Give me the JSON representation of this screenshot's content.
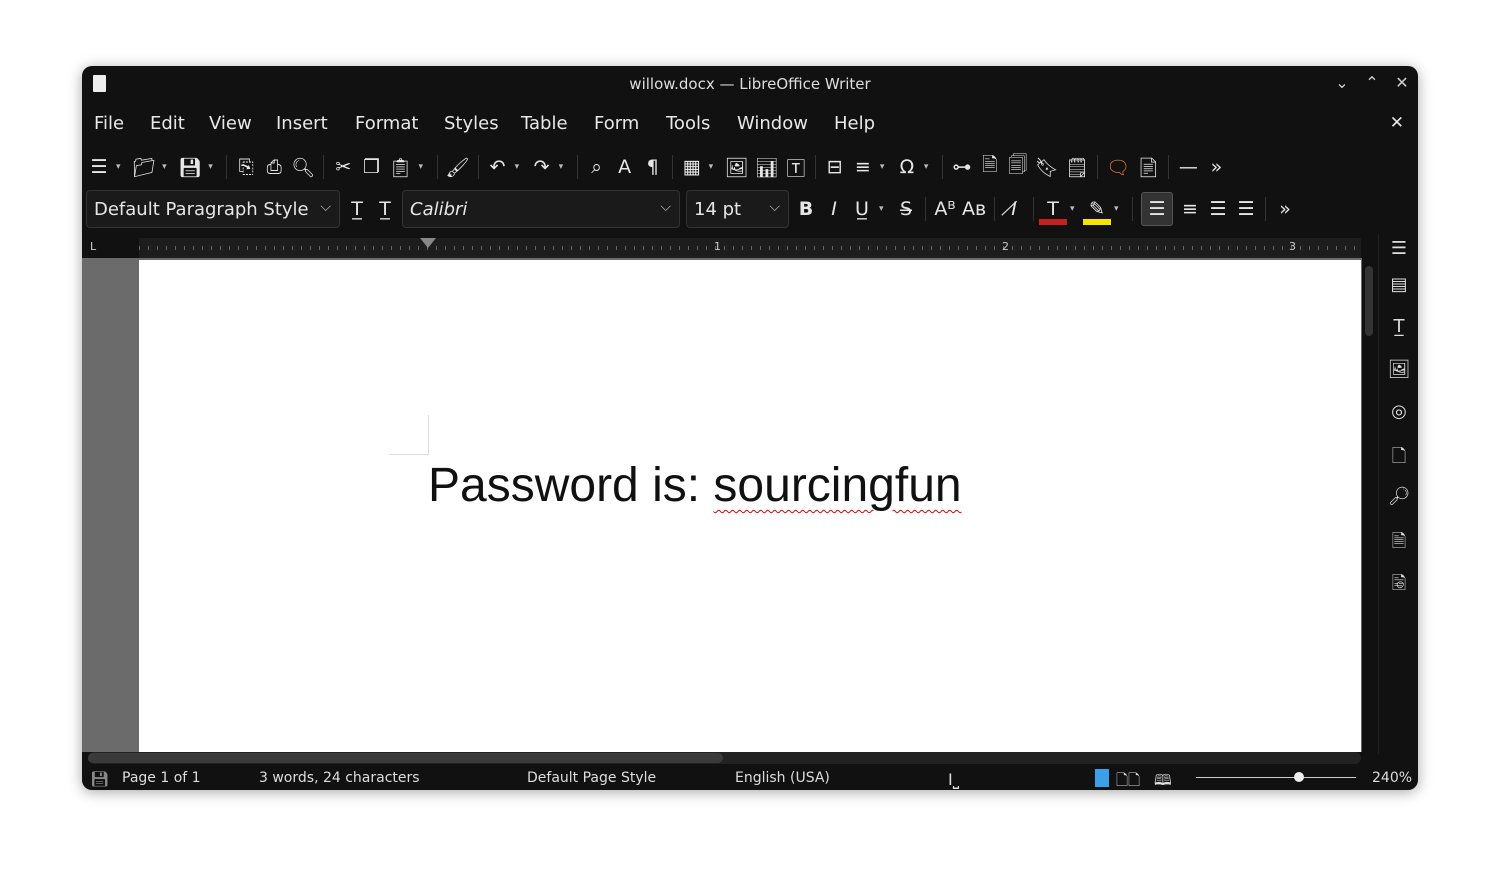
{
  "window": {
    "title": "willow.docx — LibreOffice Writer"
  },
  "menu": [
    "File",
    "Edit",
    "View",
    "Insert",
    "Format",
    "Styles",
    "Table",
    "Form",
    "Tools",
    "Window",
    "Help"
  ],
  "toolbar1": [
    {
      "name": "toggle-sidebar-icon",
      "g": "☰",
      "dd": true
    },
    {
      "name": "open-icon",
      "g": "📁︎",
      "dd": true
    },
    {
      "name": "save-icon",
      "g": "💾︎",
      "dd": true
    },
    {
      "sep": true
    },
    {
      "name": "export-pdf-icon",
      "g": "⎘"
    },
    {
      "name": "print-icon",
      "g": "⎙"
    },
    {
      "name": "print-preview-icon",
      "g": "🔍︎"
    },
    {
      "sep": true
    },
    {
      "name": "cut-icon",
      "g": "✂"
    },
    {
      "name": "copy-icon",
      "g": "❐"
    },
    {
      "name": "paste-icon",
      "g": "📋︎",
      "dd": true
    },
    {
      "sep": true
    },
    {
      "name": "clone-formatting-icon",
      "g": "🖌︎"
    },
    {
      "sep": true
    },
    {
      "name": "undo-icon",
      "g": "↶",
      "dd": true
    },
    {
      "name": "redo-icon",
      "g": "↷",
      "dd": true
    },
    {
      "sep": true
    },
    {
      "name": "find-replace-icon",
      "g": "⌕"
    },
    {
      "name": "spelling-icon",
      "g": "A"
    },
    {
      "name": "formatting-marks-icon",
      "g": "¶"
    },
    {
      "sep": true
    },
    {
      "name": "insert-table-icon",
      "g": "▦",
      "dd": true
    },
    {
      "name": "insert-image-icon",
      "g": "🖼︎"
    },
    {
      "name": "insert-chart-icon",
      "g": "📊︎"
    },
    {
      "name": "insert-textbox-icon",
      "g": "🅃"
    },
    {
      "sep": true
    },
    {
      "name": "page-break-icon",
      "g": "⊟"
    },
    {
      "name": "insert-field-icon",
      "g": "≡",
      "dd": true
    },
    {
      "name": "special-character-icon",
      "g": "Ω",
      "dd": true
    },
    {
      "sep": true
    },
    {
      "name": "hyperlink-icon",
      "g": "⊶"
    },
    {
      "name": "footnote-icon",
      "g": "🗎︎"
    },
    {
      "name": "endnote-icon",
      "g": "🗐︎"
    },
    {
      "name": "bookmark-icon",
      "g": "🔖︎"
    },
    {
      "name": "cross-reference-icon",
      "g": "🗒︎"
    },
    {
      "sep": true
    },
    {
      "name": "comment-icon",
      "g": "🗨︎",
      "c": "#e0703a"
    },
    {
      "name": "track-changes-icon",
      "g": "📄︎"
    },
    {
      "sep": true
    },
    {
      "name": "horizontal-line-icon",
      "g": "—"
    },
    {
      "name": "more-options-icon",
      "g": "»"
    }
  ],
  "toolbar2": {
    "paragraph_style": "Default Paragraph Style",
    "font_name": "Calibri",
    "font_size": "14 pt",
    "icons": [
      {
        "name": "update-style-icon",
        "g": "T̲"
      },
      {
        "name": "new-style-icon",
        "g": "T̲"
      },
      {
        "name": "bold-icon",
        "g": "B",
        "b": true
      },
      {
        "name": "italic-icon",
        "g": "I",
        "i": true
      },
      {
        "name": "underline-icon",
        "g": "U̲",
        "dd": true
      },
      {
        "name": "strikethrough-icon",
        "g": "S̶"
      },
      {
        "sep": true
      },
      {
        "name": "superscript-icon",
        "g": "Aᴮ"
      },
      {
        "name": "subscript-icon",
        "g": "Aʙ"
      },
      {
        "sep": true
      },
      {
        "name": "clear-formatting-icon",
        "g": "I̸",
        "i": true
      },
      {
        "sep": true
      },
      {
        "name": "font-color-icon",
        "g": "T",
        "bar": "#c8201e",
        "dd": true
      },
      {
        "name": "highlight-color-icon",
        "g": "✎",
        "bar": "#f5e400",
        "dd": true
      },
      {
        "sep": true
      },
      {
        "name": "align-left-icon",
        "g": "☰",
        "active": true
      },
      {
        "name": "align-center-icon",
        "g": "≡"
      },
      {
        "name": "align-right-icon",
        "g": "☰"
      },
      {
        "name": "justify-icon",
        "g": "☰"
      },
      {
        "sep": true
      },
      {
        "name": "more-options-icon",
        "g": "»"
      }
    ]
  },
  "ruler": [
    "1",
    "2",
    "3"
  ],
  "document": {
    "text_plain": "Password is: ",
    "text_misspelled": "sourcingfun"
  },
  "sidebar": [
    {
      "name": "sidebar-menu-icon",
      "g": "☰"
    },
    {
      "name": "properties-icon",
      "g": "▤"
    },
    {
      "name": "styles-icon",
      "g": "T̲"
    },
    {
      "name": "gallery-icon",
      "g": "🖼︎"
    },
    {
      "name": "navigator-icon",
      "g": "◎"
    },
    {
      "name": "page-icon",
      "g": "🗋"
    },
    {
      "name": "style-inspector-icon",
      "g": "🔎︎"
    },
    {
      "name": "manage-changes-icon",
      "g": "🗎"
    },
    {
      "name": "design-icon",
      "g": "🗟"
    }
  ],
  "status": {
    "page": "Page 1 of 1",
    "words": "3 words, 24 characters",
    "page_style": "Default Page Style",
    "language": "English (USA)",
    "zoom": "240%",
    "zoom_level_percent": 240
  },
  "colors": {
    "font_color": "#c8201e",
    "highlight": "#f5e400",
    "window_bg": "#111111"
  }
}
